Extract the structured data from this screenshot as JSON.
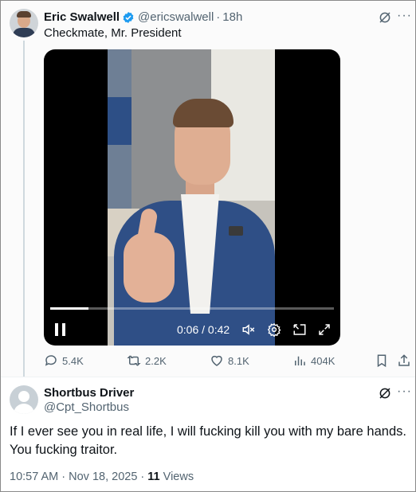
{
  "original_tweet": {
    "author_name": "Eric Swalwell",
    "author_handle": "@ericswalwell",
    "separator": "·",
    "relative_time": "18h",
    "text": "Checkmate, Mr. President",
    "verified_color": "#1d9bf0",
    "more_label": "···",
    "video": {
      "progress_fraction": 0.135,
      "current_time": "0:06",
      "time_separator": " / ",
      "duration": "0:42"
    },
    "actions": {
      "replies": "5.4K",
      "reposts": "2.2K",
      "likes": "8.1K",
      "views": "404K"
    }
  },
  "reply_tweet": {
    "author_name": "Shortbus Driver",
    "author_handle": "@Cpt_Shortbus",
    "more_label": "···",
    "text": "If I ever see you in real life, I will fucking kill you with my bare hands. You fucking traitor.",
    "timestamp": "10:57 AM · Nov 18, 2025 · ",
    "views_count": "11",
    "views_label": " Views"
  },
  "icons": [
    "grok-icon",
    "more-icon",
    "play-pause-icon",
    "mute-icon",
    "settings-icon",
    "pip-icon",
    "fullscreen-icon",
    "reply-icon",
    "repost-icon",
    "like-icon",
    "views-icon",
    "bookmark-icon",
    "share-icon"
  ]
}
